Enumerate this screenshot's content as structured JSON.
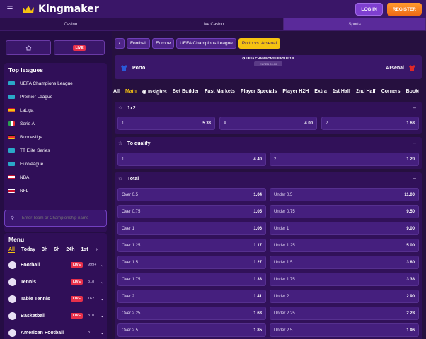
{
  "header": {
    "logo_text": "Kingmaker",
    "login_label": "LOG IN",
    "register_label": "REGISTER"
  },
  "topnav": [
    "Casino",
    "Live Casino",
    "Sports"
  ],
  "sidebar": {
    "live_label": "LIVE",
    "top_leagues_title": "Top leagues",
    "leagues": [
      {
        "name": "UEFA Champions League",
        "flag": "#2aa8c8"
      },
      {
        "name": "Premier League",
        "flag": "#2aa8c8"
      },
      {
        "name": "LaLiga",
        "flag": "#e8a020"
      },
      {
        "name": "Serie A",
        "flag": "#2aa050"
      },
      {
        "name": "Bundesliga",
        "flag": "#e83030"
      },
      {
        "name": "TT Elite Series",
        "flag": "#2aa8c8"
      },
      {
        "name": "Euroleague",
        "flag": "#2aa8c8"
      },
      {
        "name": "NBA",
        "flag": "#c83a5a"
      },
      {
        "name": "NFL",
        "flag": "#c83a5a"
      }
    ],
    "search_placeholder": "Enter Team or Championship name",
    "menu_title": "Menu",
    "menu_tabs": [
      "All",
      "Today",
      "3h",
      "6h",
      "24h",
      "1st"
    ],
    "sports": [
      {
        "name": "Football",
        "live": "LIVE",
        "count": "999+"
      },
      {
        "name": "Tennis",
        "live": "LIVE",
        "count": "318"
      },
      {
        "name": "Table Tennis",
        "live": "LIVE",
        "count": "162"
      },
      {
        "name": "Basketball",
        "live": "LIVE",
        "count": "310"
      },
      {
        "name": "American Football",
        "live": "",
        "count": "31"
      }
    ]
  },
  "breadcrumbs": [
    "Football",
    "Europe",
    "UEFA Champions League",
    "Porto vs. Arsenal"
  ],
  "match": {
    "league": "UEFA CHAMPIONS LEAGUE",
    "stage": "1/8",
    "datetime": "21 FEB 20:00",
    "home": "Porto",
    "away": "Arsenal"
  },
  "market_tabs": [
    "All",
    "Main",
    "Insights",
    "Bet Builder",
    "Fast Markets",
    "Player Specials",
    "Player H2H",
    "Extra",
    "1st Half",
    "2nd Half",
    "Corners",
    "Bookings"
  ],
  "markets": {
    "m1x2": {
      "title": "1x2",
      "odds": [
        {
          "label": "1",
          "value": "5.33"
        },
        {
          "label": "X",
          "value": "4.00"
        },
        {
          "label": "2",
          "value": "1.63"
        }
      ]
    },
    "qualify": {
      "title": "To qualify",
      "odds": [
        {
          "label": "1",
          "value": "4.40"
        },
        {
          "label": "2",
          "value": "1.20"
        }
      ]
    },
    "total": {
      "title": "Total",
      "rows": [
        {
          "over": "Over 0.5",
          "over_val": "1.04",
          "under": "Under 0.5",
          "under_val": "11.00"
        },
        {
          "over": "Over 0.75",
          "over_val": "1.05",
          "under": "Under 0.75",
          "under_val": "9.50"
        },
        {
          "over": "Over 1",
          "over_val": "1.06",
          "under": "Under 1",
          "under_val": "9.00"
        },
        {
          "over": "Over 1.25",
          "over_val": "1.17",
          "under": "Under 1.25",
          "under_val": "5.00"
        },
        {
          "over": "Over 1.5",
          "over_val": "1.27",
          "under": "Under 1.5",
          "under_val": "3.80"
        },
        {
          "over": "Over 1.75",
          "over_val": "1.33",
          "under": "Under 1.75",
          "under_val": "3.33"
        },
        {
          "over": "Over 2",
          "over_val": "1.41",
          "under": "Under 2",
          "under_val": "2.90"
        },
        {
          "over": "Over 2.25",
          "over_val": "1.63",
          "under": "Under 2.25",
          "under_val": "2.28"
        },
        {
          "over": "Over 2.5",
          "over_val": "1.85",
          "under": "Under 2.5",
          "under_val": "1.96"
        }
      ]
    }
  }
}
